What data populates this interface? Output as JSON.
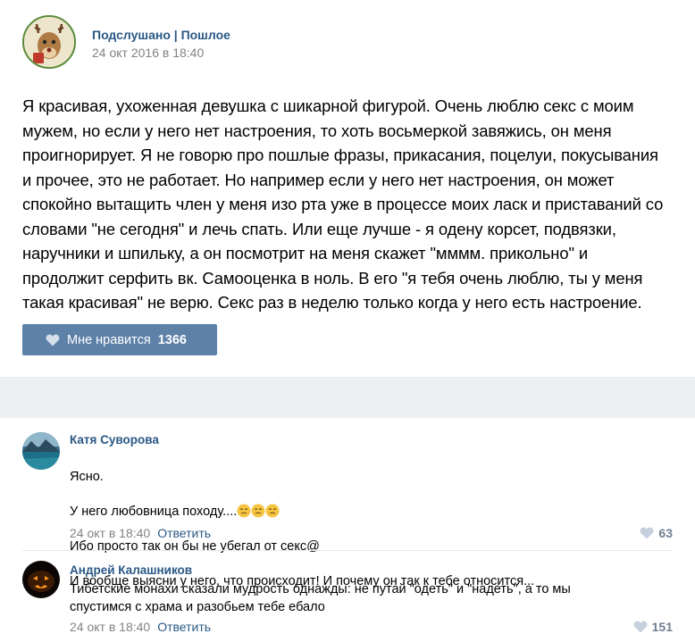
{
  "post": {
    "group_name": "Подслушано | Пошлое",
    "date": "24 окт 2016 в 18:40",
    "text": "Я красивая, ухоженная девушка с шикарной фигурой. Очень люблю секс с моим\nмужем, но если у него нет настроения, то хоть восьмеркой завяжись, он меня\nпроигнорирует. Я не говорю про пошлые фразы, прикасания, поцелуи, покусывания\nи прочее, это не работает. Но например если у него нет настроения, он может\nспокойно вытащить член у меня изо рта уже в процессе моих ласк и приставаний со\nсловами \"не сегодня\" и лечь спать. Или еще лучше - я одену корсет, подвязки,\nнаручники и шпильку, а он посмотрит на меня скажет \"мммм. прикольно\" и\nпродолжит серфить вк. Самооценка в ноль. В его \"я тебя очень люблю, ты у меня\nтакая красивая\" не верю. Секс раз в неделю только когда у него есть настроение.",
    "like_label": "Мне нравится",
    "like_count": "1366"
  },
  "comments": [
    {
      "author": "Катя Суворова",
      "line1": "Ясно.",
      "line2": "У него любовница походу....",
      "line3": "Ибо просто так он бы не убегал от секс@",
      "line4": "И вообще выясни у него, что происходит! И почему он так к тебе относится...",
      "date": "24 окт в 18:40",
      "reply": "Ответить",
      "likes": "63"
    },
    {
      "author": "Андрей Калашников",
      "text": "Тибетские монахи сказали мудрость однажды: не путай \"одеть\" и \"надеть\", а то мы\nспустимся с храма и разобьем тебе ебало",
      "date": "24 окт в 18:40",
      "reply": "Ответить",
      "likes": "151"
    }
  ],
  "icons": {
    "heart": "heart-icon",
    "emoji": "confused-face-emoji"
  },
  "colors": {
    "link": "#2a5885",
    "like_button": "#5e81a8",
    "meta": "#828282",
    "separator": "#edeef0"
  }
}
